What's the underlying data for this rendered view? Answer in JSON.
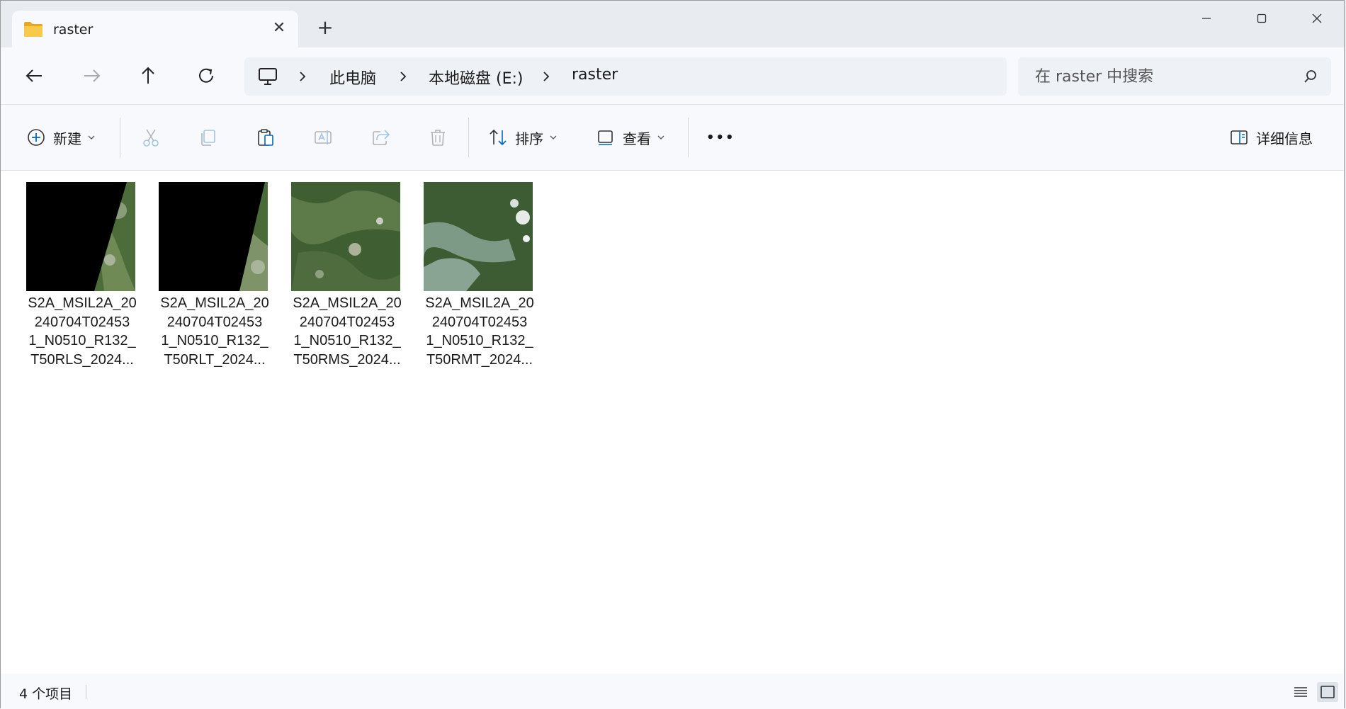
{
  "tab": {
    "title": "raster",
    "close_label": "✕",
    "new_tab_label": "+"
  },
  "window_controls": {
    "minimize": "—",
    "maximize": "☐",
    "close": "✕"
  },
  "breadcrumb": {
    "items": [
      "此电脑",
      "本地磁盘 (E:)",
      "raster"
    ]
  },
  "search": {
    "placeholder": "在 raster 中搜索"
  },
  "toolbar": {
    "new_label": "新建",
    "sort_label": "排序",
    "view_label": "查看",
    "more_label": "•••",
    "details_label": "详细信息"
  },
  "files": [
    {
      "name": "S2A_MSIL2A_20240704T024531_N0510_R132_T50RLS_2024...",
      "lines": [
        "S2A_MSIL2A_20",
        "240704T02453",
        "1_N0510_R132_",
        "T50RLS_2024..."
      ]
    },
    {
      "name": "S2A_MSIL2A_20240704T024531_N0510_R132_T50RLT_2024...",
      "lines": [
        "S2A_MSIL2A_20",
        "240704T02453",
        "1_N0510_R132_",
        "T50RLT_2024..."
      ]
    },
    {
      "name": "S2A_MSIL2A_20240704T024531_N0510_R132_T50RMS_2024...",
      "lines": [
        "S2A_MSIL2A_20",
        "240704T02453",
        "1_N0510_R132_",
        "T50RMS_2024..."
      ]
    },
    {
      "name": "S2A_MSIL2A_20240704T024531_N0510_R132_T50RMT_2024...",
      "lines": [
        "S2A_MSIL2A_20",
        "240704T02453",
        "1_N0510_R132_",
        "T50RMT_2024..."
      ]
    }
  ],
  "status": {
    "item_count": "4 个项目"
  },
  "colors": {
    "accent": "#0067c0",
    "folder": "#f4c542",
    "chrome": "#f7f9fc"
  }
}
